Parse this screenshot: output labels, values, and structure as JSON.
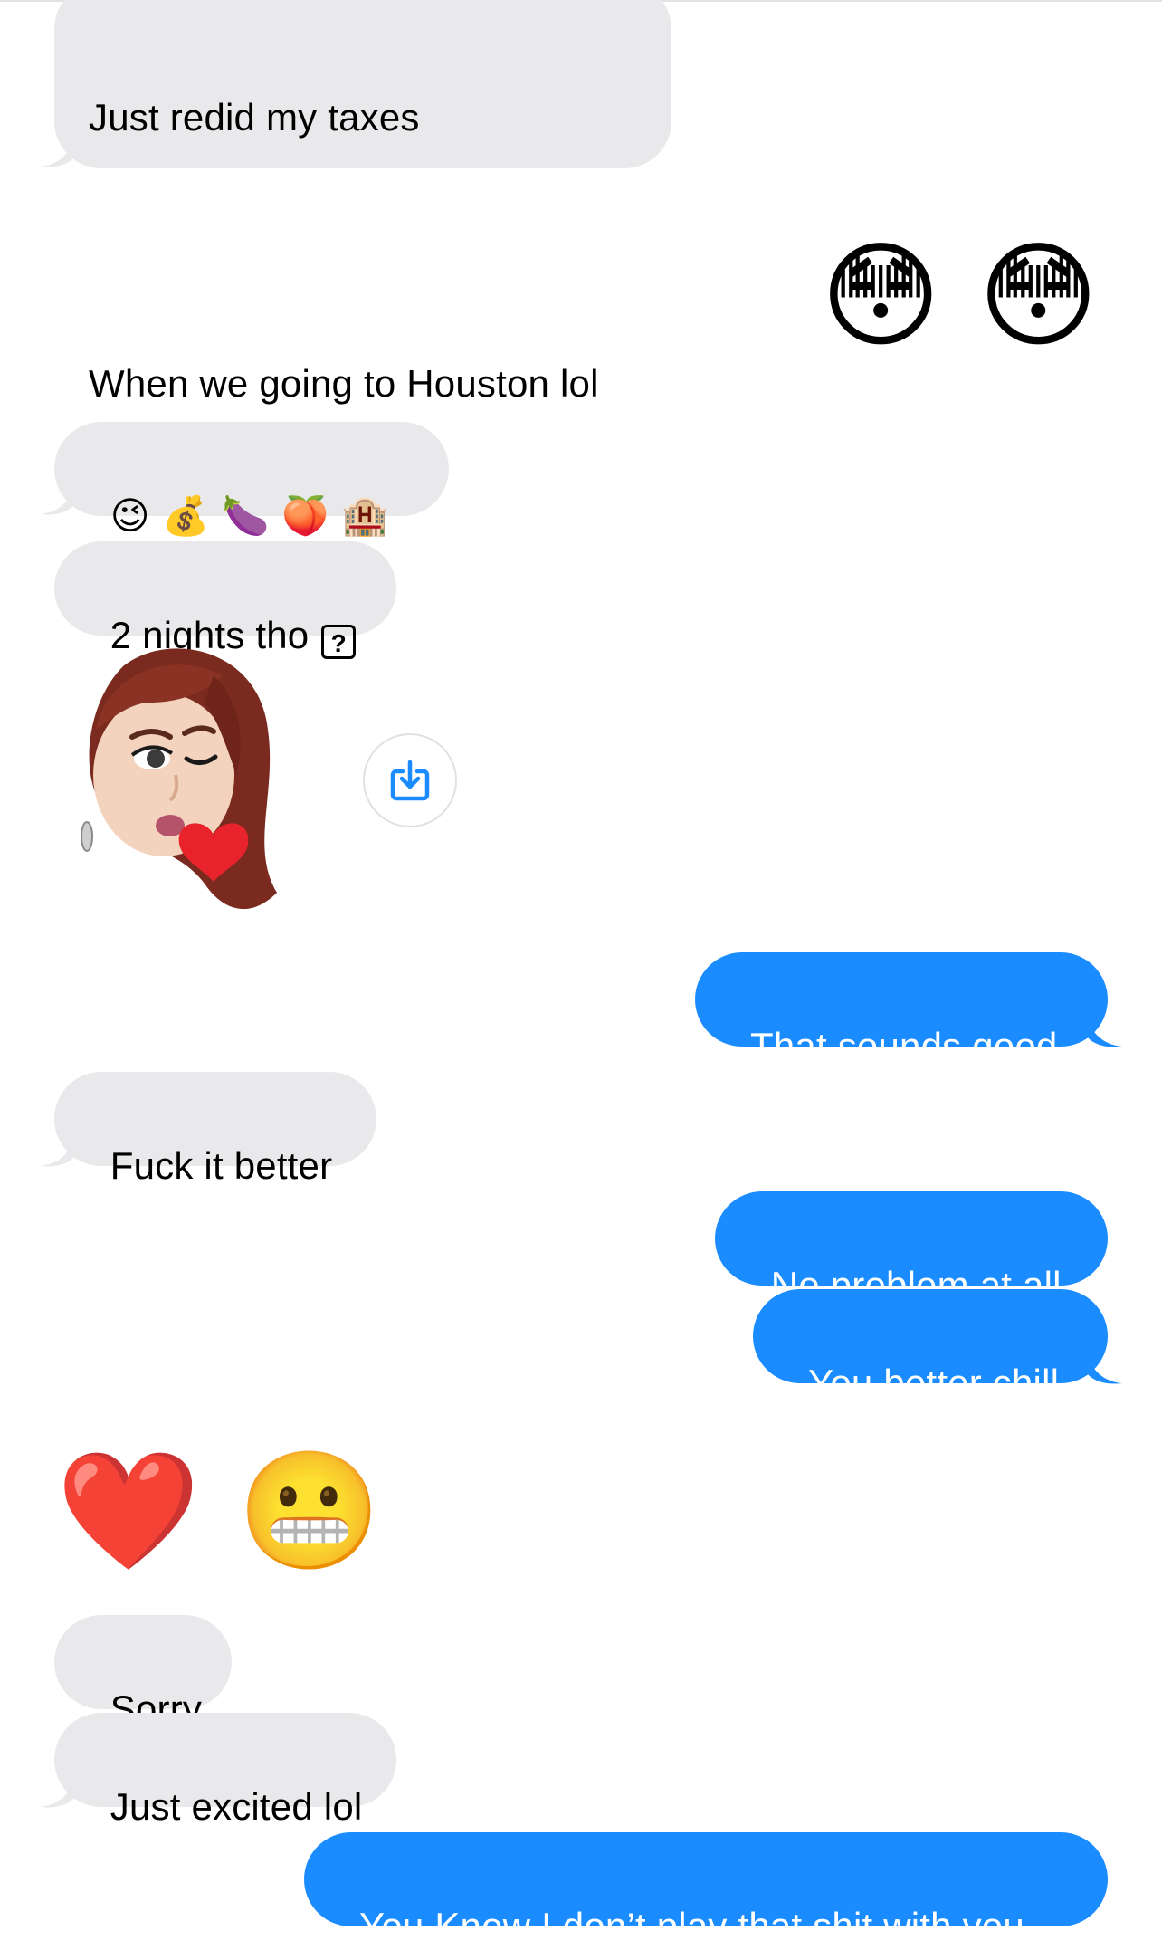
{
  "messages": {
    "m1_line1": "Just redid my taxes",
    "m1_line2": "When we going to Houston lol",
    "m2_emoji": "😳 😳",
    "m3_emojis": "😉 💰 🍆 🍑 🏨",
    "m4_text": "2 nights tho",
    "m4_symbol": "?",
    "m5_memoji_name": "memoji-kiss-sticker",
    "m6": "That sounds good",
    "m7": "Fuck it better",
    "m8": "No problem at all",
    "m9": "You better chill",
    "m10_emoji": "❤️ 😬",
    "m11": "Sorry",
    "m12": "Just excited lol",
    "m13": "You Know I don’t play that shit with you"
  },
  "icons": {
    "save": "download-icon"
  },
  "colors": {
    "incoming_bubble": "#e9e9eb",
    "outgoing_bubble": "#1a8cff",
    "save_icon": "#1a8cff"
  }
}
